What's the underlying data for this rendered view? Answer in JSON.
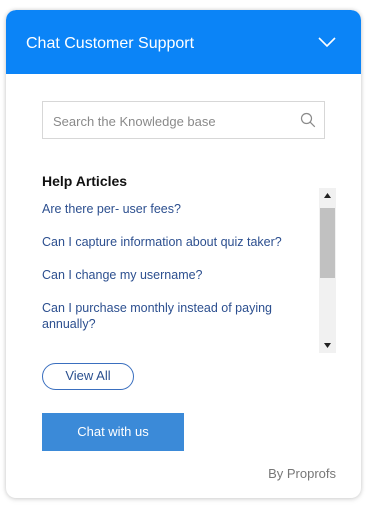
{
  "header": {
    "title": "Chat Customer Support",
    "collapse_icon": "chevron-down-icon",
    "background_color": "#0b84f7"
  },
  "search": {
    "placeholder": "Search the Knowledge base",
    "value": "",
    "icon": "search-icon"
  },
  "help": {
    "title": "Help Articles",
    "articles": [
      "Are there per- user fees?",
      "Can I capture information about quiz taker?",
      "Can I change my username?",
      "Can I purchase monthly instead of paying annually?"
    ]
  },
  "view_all_label": "View All",
  "chat_button_label": "Chat with us",
  "powered_by": "By Proprofs",
  "colors": {
    "link": "#2c4f8f",
    "chat_button": "#3b8ad8"
  }
}
